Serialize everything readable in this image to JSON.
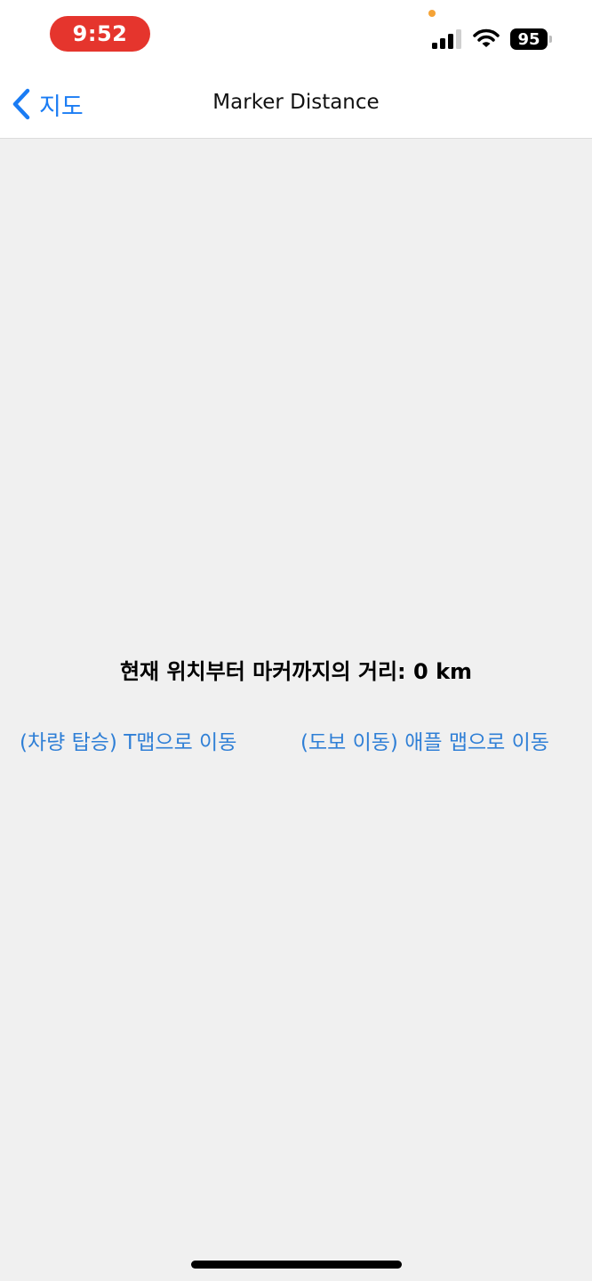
{
  "status_bar": {
    "time": "9:52",
    "battery_level": "95",
    "icons": [
      "privacy-indicator-dot",
      "cellular-signal-icon",
      "wifi-icon",
      "battery-icon"
    ],
    "colors": {
      "time_pill": "#e5352d",
      "privacy_dot": "#f5a336"
    }
  },
  "nav": {
    "back_label": "지도",
    "title": "Marker Distance",
    "accent_color": "#1a7cf4"
  },
  "main": {
    "distance_label": "현재 위치부터 마커까지의 거리: 0 km",
    "actions": [
      {
        "label": "(차량 탑승) T맵으로 이동"
      },
      {
        "label": "(도보 이동) 애플 맵으로 이동"
      }
    ],
    "link_color": "#2f7fd6"
  }
}
